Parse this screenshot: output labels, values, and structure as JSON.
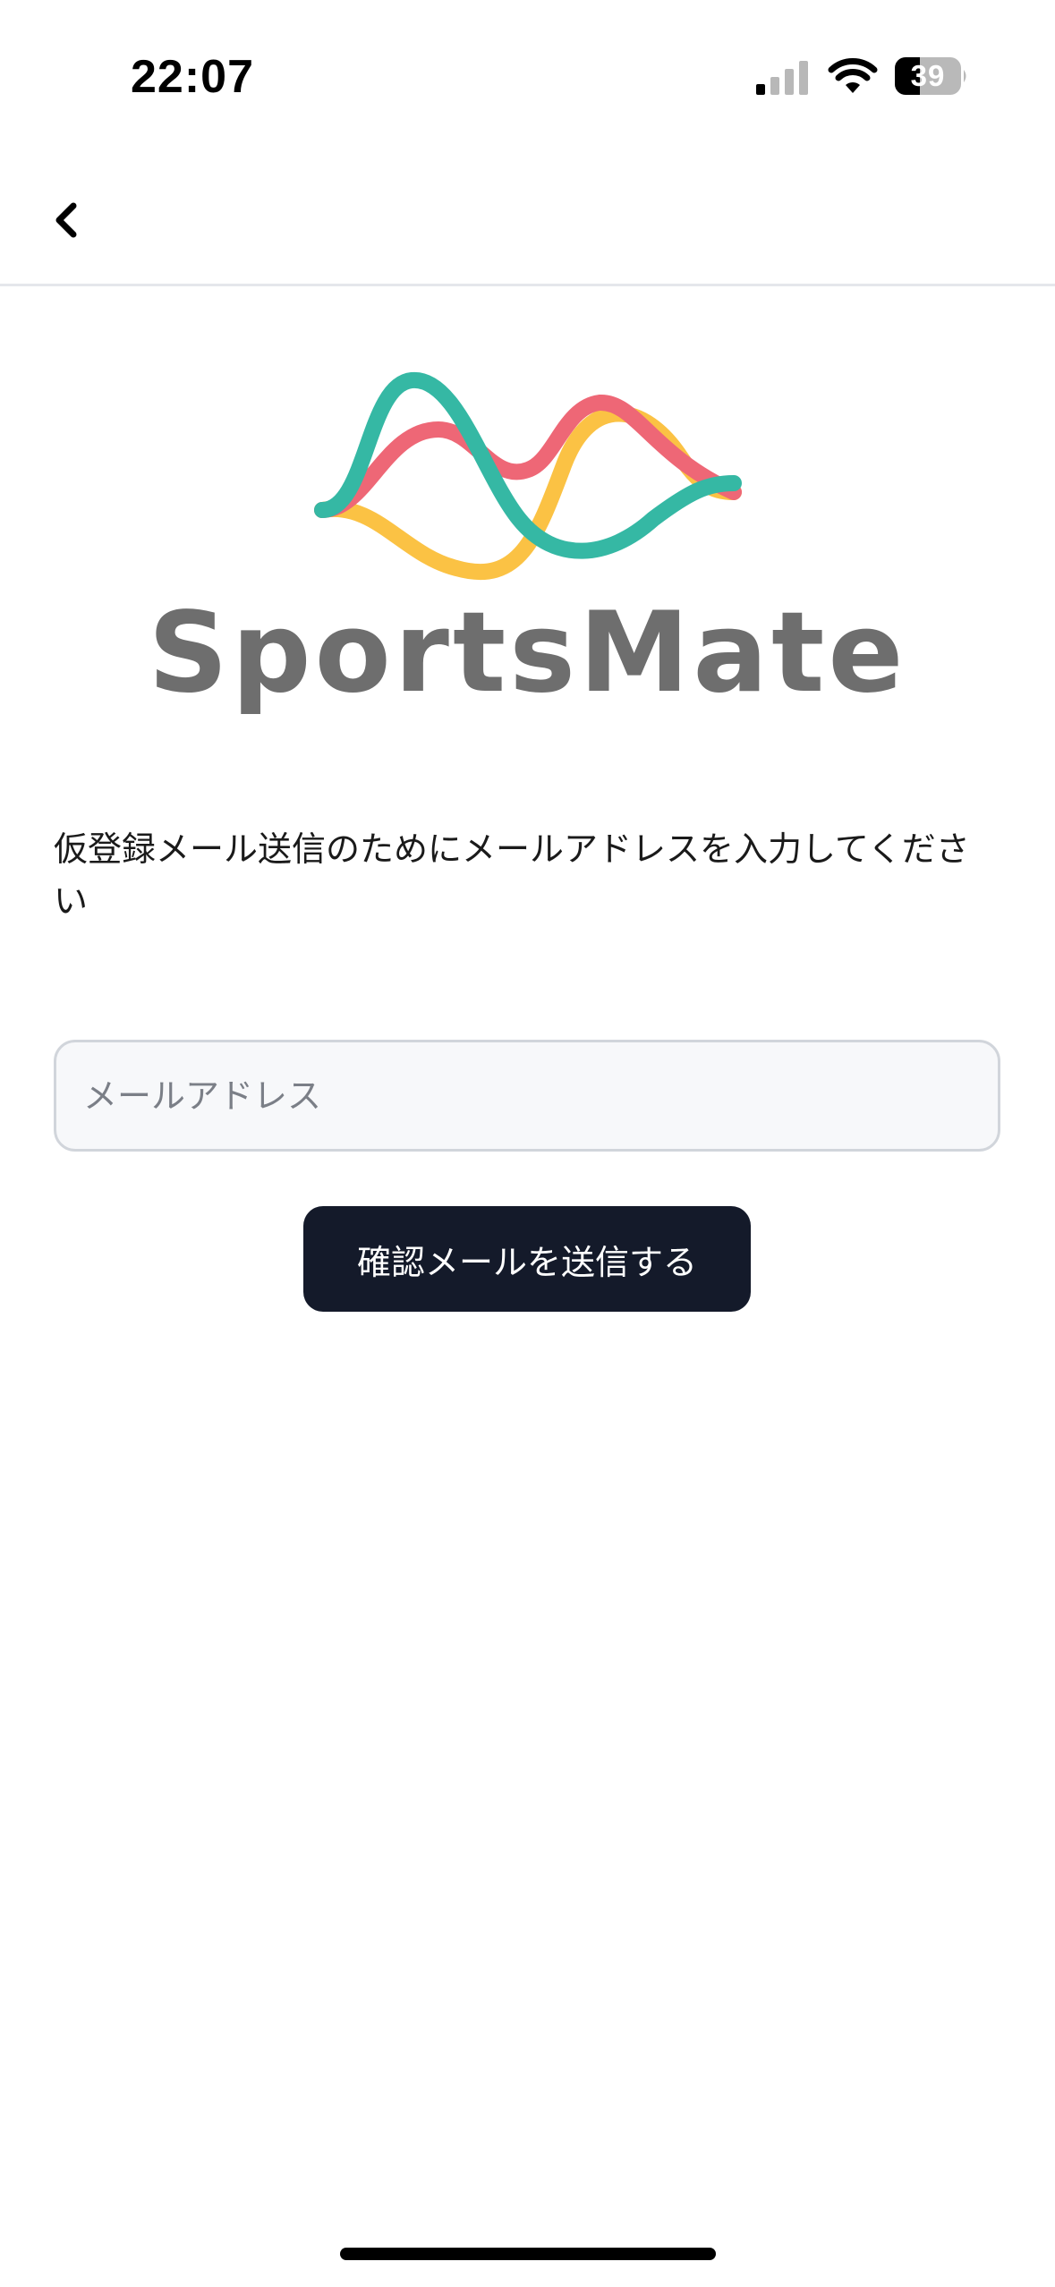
{
  "status_bar": {
    "time": "22:07",
    "battery_level": "39",
    "icons": [
      "signal-icon",
      "wifi-icon",
      "battery-icon"
    ]
  },
  "nav": {
    "back_icon": "chevron-left-icon"
  },
  "logo": {
    "text": "SportsMate",
    "colors": {
      "teal": "#35b8a4",
      "red": "#ee6776",
      "yellow": "#fbc244",
      "text": "#6e6e6e"
    }
  },
  "form": {
    "instruction": "仮登録メール送信のためにメールアドレスを入力してください",
    "email_placeholder": "メールアドレス",
    "email_value": "",
    "submit_label": "確認メールを送信する"
  },
  "colors": {
    "button_bg": "#141a2a",
    "input_bg": "#f7f8fa",
    "input_border": "#d1d5db",
    "divider": "#e5e7eb"
  }
}
